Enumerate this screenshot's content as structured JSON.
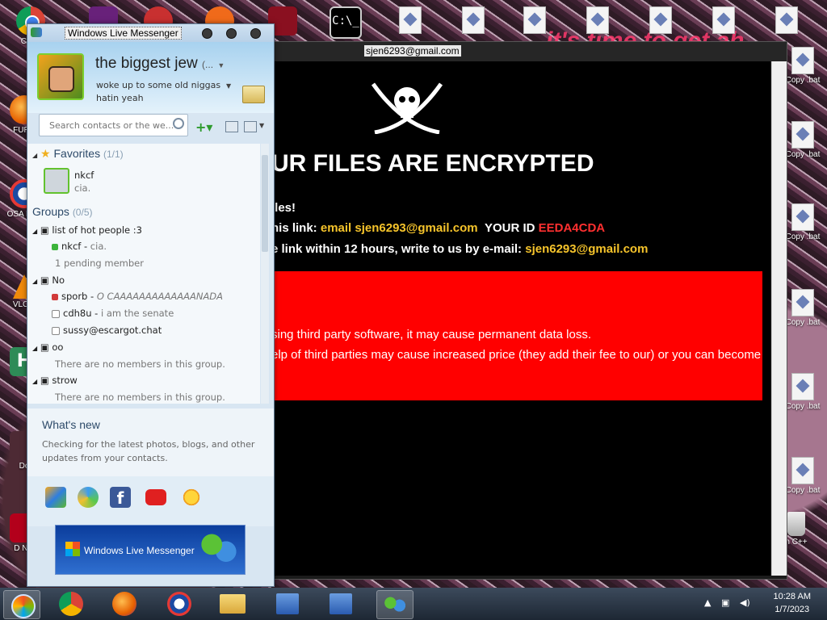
{
  "desktop": {
    "left_icons": [
      {
        "label": "CH D",
        "icon": "chrome-icon"
      },
      {
        "label": "FURR",
        "icon": "firefox-icon"
      },
      {
        "label": "OSA LAD",
        "icon": "obama-icon"
      },
      {
        "label": "VLC F",
        "icon": "vlc-icon"
      },
      {
        "label": "H",
        "icon": "app-icon"
      },
      {
        "label": "Do",
        "icon": "app-icon"
      },
      {
        "label": "D Not",
        "icon": "app-icon"
      }
    ],
    "right_icons": [
      {
        "label": "Copy .bat"
      },
      {
        "label": "Copy .bat"
      },
      {
        "label": "Copy .bat"
      },
      {
        "label": "Copy .bat"
      },
      {
        "label": "Copy .bat"
      },
      {
        "label": "Copy .bat"
      },
      {
        "label": "n C++"
      }
    ],
    "banner_text": "it's time to get ah"
  },
  "ransom_window": {
    "title": "sjen6293@gmail.com",
    "headline": "UR FILES ARE ENCRYPTED",
    "line1": "iles!",
    "line2_prefix": "his link:",
    "line2_email": "email sjen6293@gmail.com",
    "line2_id_label": "YOUR ID",
    "line2_id": "EEDA4CDA",
    "line3_prefix": "e link within 12 hours, write to us by e-mail:",
    "line3_email": "sjen6293@gmail.com",
    "warning1": "sing third party software, it may cause permanent data loss.",
    "warning2": "elp of third parties may cause increased price (they add their fee to our) or you can become"
  },
  "messenger": {
    "title": "Windows Live Messenger",
    "display_name": "the biggest jew",
    "display_name_suffix": "(...",
    "personal_message_1": "woke up to some old niggas",
    "personal_message_2": "hatin yeah",
    "search_placeholder": "Search contacts or the we...",
    "favorites": {
      "label": "Favorites",
      "count": "(1/1)"
    },
    "favorite_contact": {
      "name": "nkcf",
      "status": "cia."
    },
    "groups": {
      "label": "Groups",
      "count": "(0/5)"
    },
    "group_list": [
      {
        "name": "list of hot people :3"
      },
      {
        "name": "No"
      },
      {
        "name": "oo"
      },
      {
        "name": "strow"
      }
    ],
    "members": {
      "hot1_name": "nkcf",
      "hot1_msg": "cia.",
      "hot_pending": "1 pending member",
      "no1_name": "sporb",
      "no1_msg": "O CAAAAAAAAAAAAANADA",
      "no2_name": "cdh8u",
      "no2_msg": "i am the senate",
      "no3_name": "sussy@escargot.chat",
      "oo_empty": "There are no members in this group.",
      "strow_empty": "There are no members in this group."
    },
    "whats_new_title": "What's new",
    "whats_new_body": "Checking for the latest photos, blogs, and other updates from your contacts.",
    "banner_text": "Windows Live Messenger"
  },
  "taskbar": {
    "time": "10:28 AM",
    "date": "1/7/2023"
  },
  "colors": {
    "ransom_bg": "#000000",
    "ransom_red": "#ff0000",
    "accent_yellow": "#f6c42b",
    "accent_red_text": "#ff3030",
    "wlm_header": "#a8d2ef"
  }
}
